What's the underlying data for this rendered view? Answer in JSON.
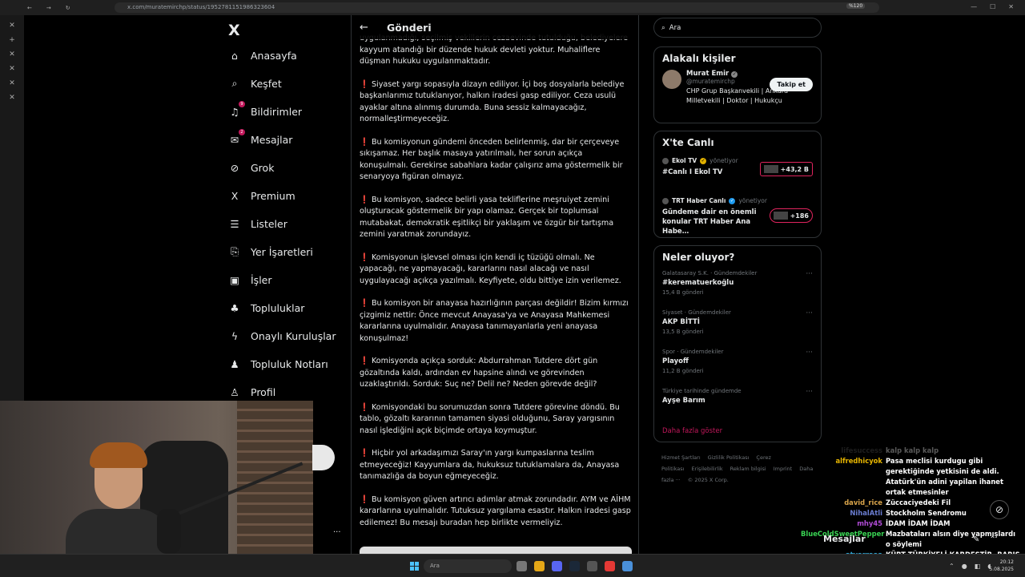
{
  "browser": {
    "url": "x.com/muratemirchp/status/1952781151986323604",
    "zoom": "%120"
  },
  "sidebar": {
    "logo": "X",
    "items": [
      {
        "label": "Anasayfa",
        "icon": "home-icon",
        "badge": ""
      },
      {
        "label": "Keşfet",
        "icon": "search-icon",
        "badge": ""
      },
      {
        "label": "Bildirimler",
        "icon": "bell-icon",
        "badge": "9"
      },
      {
        "label": "Mesajlar",
        "icon": "mail-icon",
        "badge": "2"
      },
      {
        "label": "Grok",
        "icon": "grok-icon",
        "badge": ""
      },
      {
        "label": "Premium",
        "icon": "x-premium-icon",
        "badge": ""
      },
      {
        "label": "Listeler",
        "icon": "list-icon",
        "badge": ""
      },
      {
        "label": "Yer İşaretleri",
        "icon": "bookmark-icon",
        "badge": ""
      },
      {
        "label": "İşler",
        "icon": "briefcase-icon",
        "badge": ""
      },
      {
        "label": "Topluluklar",
        "icon": "people-icon",
        "badge": ""
      },
      {
        "label": "Onaylı Kuruluşlar",
        "icon": "lightning-icon",
        "badge": ""
      },
      {
        "label": "Topluluk Notları",
        "icon": "community-notes-icon",
        "badge": ""
      },
      {
        "label": "Profil",
        "icon": "person-icon",
        "badge": ""
      }
    ]
  },
  "main": {
    "title": "Gönderi",
    "paragraphs": [
      {
        "mark": "",
        "text": "uygulanmadığı, seçilmiş vekillerin cezaevinde tutulduğu, belediyelere kayyum atandığı bir düzende hukuk devleti yoktur. Muhaliflere düşman hukuku uygulanmaktadır."
      },
      {
        "mark": "❗",
        "text": "Siyaset yargı sopasıyla dizayn ediliyor. İçi boş dosyalarla belediye başkanlarımız tutuklanıyor, halkın iradesi gasp ediliyor. Ceza usulü ayaklar altına alınmış durumda. Buna sessiz kalmayacağız, normalleştirmeyeceğiz."
      },
      {
        "mark": "❗",
        "text": "Bu komisyonun gündemi önceden belirlenmiş, dar bir çerçeveye sıkışamaz. Her başlık masaya yatırılmalı, her sorun açıkça konuşulmalı. Gerekirse sabahlara kadar çalışırız ama göstermelik bir senaryoya figüran olmayız."
      },
      {
        "mark": "❗",
        "text": "Bu komisyon, sadece belirli yasa tekliflerine meşruiyet zemini oluşturacak göstermelik bir yapı olamaz. Gerçek bir toplumsal mutabakat, demokratik eşitlikçi bir yaklaşım ve özgür bir tartışma zemini yaratmak zorundayız."
      },
      {
        "mark": "❗",
        "text": "Komisyonun işlevsel olması için kendi iç tüzüğü olmalı. Ne yapacağı, ne yapmayacağı, kararlarını nasıl alacağı ve nasıl uygulayacağı açıkça yazılmalı. Keyfiyete, oldu bittiye izin verilemez."
      },
      {
        "mark": "❗",
        "text": "Bu komisyon bir anayasa hazırlığının parçası değildir! Bizim kırmızı çizgimiz nettir: Önce mevcut Anayasa'ya ve Anayasa Mahkemesi kararlarına uyulmalıdır. Anayasa tanımayanlarla yeni anayasa konuşulmaz!"
      },
      {
        "mark": "❗",
        "text": "Komisyonda açıkça sorduk: Abdurrahman Tutdere dört gün gözaltında kaldı, ardından ev hapsine alındı ve görevinden uzaklaştırıldı. Sorduk: Suç ne? Delil ne? Neden görevde değil?"
      },
      {
        "mark": "❗",
        "text": "Komisyondaki bu sorumuzdan sonra Tutdere görevine döndü. Bu tablo, gözaltı kararının tamamen siyasi olduğunu, Saray yargısının nasıl işlediğini açık biçimde ortaya koymuştur."
      },
      {
        "mark": "❗",
        "text": "Hiçbir yol arkadaşımızı Saray'ın yargı kumpaslarına teslim etmeyeceğiz! Kayyumlara da, hukuksuz tutuklamalara da, Anayasa tanımazlığa da boyun eğmeyeceğiz."
      },
      {
        "mark": "❗",
        "text": "Bu komisyon güven artırıcı adımlar atmak zorundadır. AYM ve AİHM kararlarına uyulmalıdır. Tutuksuz yargılama esastır. Halkın iradesi gasp edilemez! Bu mesajı buradan hep birlikte vermeliyiz."
      }
    ]
  },
  "right": {
    "search_placeholder": "Ara",
    "related": {
      "title": "Alakalı kişiler",
      "name": "Murat Emir",
      "handle": "@muratemirchp",
      "bio": "CHP Grup Başkanvekili | Ankara Milletvekili | Doktor | Hukukçu",
      "follow": "Takip et"
    },
    "live": {
      "title": "X'te Canlı",
      "items": [
        {
          "account": "Ekol TV",
          "status": "yönetiyor",
          "title": "#Canlı I Ekol TV",
          "count": "+43,2 B"
        },
        {
          "account": "TRT Haber Canlı",
          "status": "yönetiyor",
          "title": "Gündeme dair en önemli konular TRT Haber Ana Habe…",
          "count": "+186"
        }
      ]
    },
    "trends": {
      "title": "Neler oluyor?",
      "items": [
        {
          "meta": "Galatasaray S.K. · Gündemdekiler",
          "name": "#kerematuerkoğlu",
          "count": "15,4 B gönderi"
        },
        {
          "meta": "Siyaset · Gündemdekiler",
          "name": "AKP BİTTİ",
          "count": "13,5 B gönderi"
        },
        {
          "meta": "Spor · Gündemdekiler",
          "name": "Playoff",
          "count": "11,2 B gönderi"
        },
        {
          "meta": "Türkiye tarihinde gündemde",
          "name": "Ayşe Barım",
          "count": ""
        }
      ],
      "show_more": "Daha fazla göster"
    },
    "footer": [
      "Hizmet Şartları",
      "Gizlilik Politikası",
      "Çerez Politikası",
      "Erişilebilirlik",
      "Reklam bilgisi",
      "Imprint",
      "Daha fazla ···",
      "© 2025 X Corp."
    ]
  },
  "chat": [
    {
      "user": "lifesuccess",
      "msg": "kalp kalp kalp",
      "color": "#555555"
    },
    {
      "user": "alfredhicyok",
      "msg": "Pasa meclisi kurdugu gibi gerektiğinde yetkisini de aldi. Atatürk'ün adini yapilan ihanet ortak etmesinler",
      "color": "#e8b600"
    },
    {
      "user": "david_rice",
      "msg": "Züccaciyedeki Fil",
      "color": "#d9a44b"
    },
    {
      "user": "NihalAtli",
      "msg": "Stockholm Sendromu",
      "color": "#6a7dd1"
    },
    {
      "user": "mhy45",
      "msg": "İDAM İDAM İDAM",
      "color": "#b04cd6"
    },
    {
      "user": "BlueColdSweetPepper",
      "msg": "Mazbataları alsın diye yapmışlardı o söylemi",
      "color": "#39d353"
    },
    {
      "user": "atyarraaa",
      "msg": "KÜRT TÜRKİYELİ KARDEŞTİR. BARIŞ YÜZYILI",
      "color": "#2ea8d8"
    }
  ],
  "floating": {
    "messages_label": "Mesajlar"
  },
  "taskbar": {
    "search": "Ara",
    "time": "20:12",
    "date": "5.08.2025"
  }
}
